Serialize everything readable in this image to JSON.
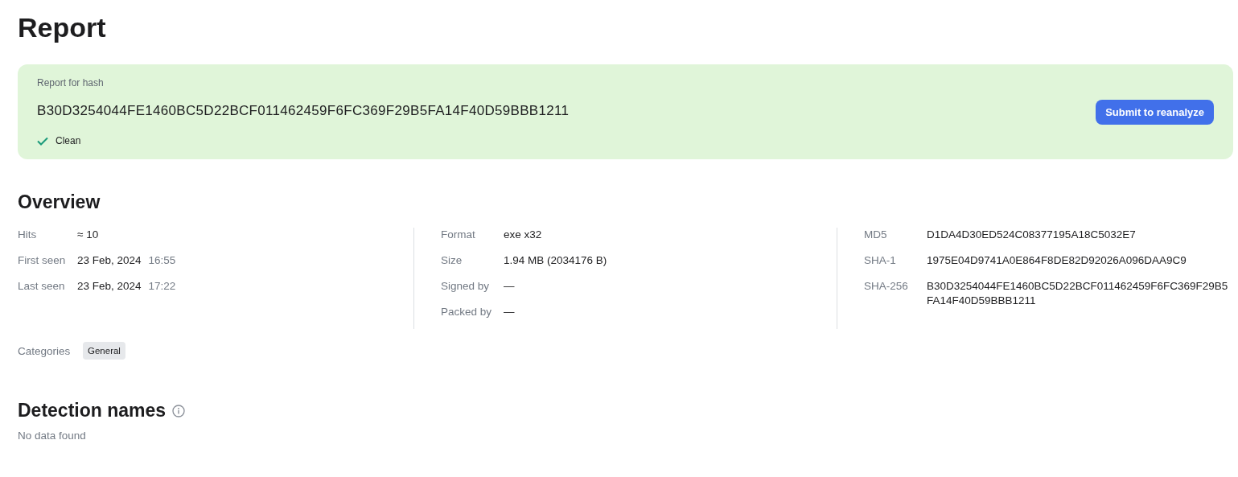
{
  "page": {
    "title": "Report"
  },
  "hash_card": {
    "caption": "Report for hash",
    "hash": "B30D3254044FE1460BC5D22BCF011462459F6FC369F29B5FA14F40D59BBB1211",
    "verdict": {
      "kind": "clean",
      "label": "Clean"
    },
    "button": "Submit to reanalyze"
  },
  "overview": {
    "title": "Overview",
    "columns": [
      [
        {
          "label": "Hits",
          "value": "≈ 10"
        },
        {
          "label": "First seen",
          "value": "23 Feb, 2024",
          "time": "16:55"
        },
        {
          "label": "Last seen",
          "value": "23 Feb, 2024",
          "time": "17:22"
        }
      ],
      [
        {
          "label": "Format",
          "value": "exe x32"
        },
        {
          "label": "Size",
          "value": "1.94 MB (2034176 B)"
        },
        {
          "label": "Signed by",
          "value": "—"
        },
        {
          "label": "Packed by",
          "value": "—"
        }
      ],
      [
        {
          "label": "MD5",
          "value": "D1DA4D30ED524C08377195A18C5032E7"
        },
        {
          "label": "SHA-1",
          "value": "1975E04D9741A0E864F8DE82D92026A096DAA9C9"
        },
        {
          "label": "SHA-256",
          "value": "B30D3254044FE1460BC5D22BCF011462459F6FC369F29B5FA14F40D59BBB1211"
        }
      ]
    ],
    "categories": {
      "label": "Categories",
      "tags": [
        "General"
      ]
    }
  },
  "detections": {
    "title": "Detection names",
    "empty": "No data found"
  }
}
